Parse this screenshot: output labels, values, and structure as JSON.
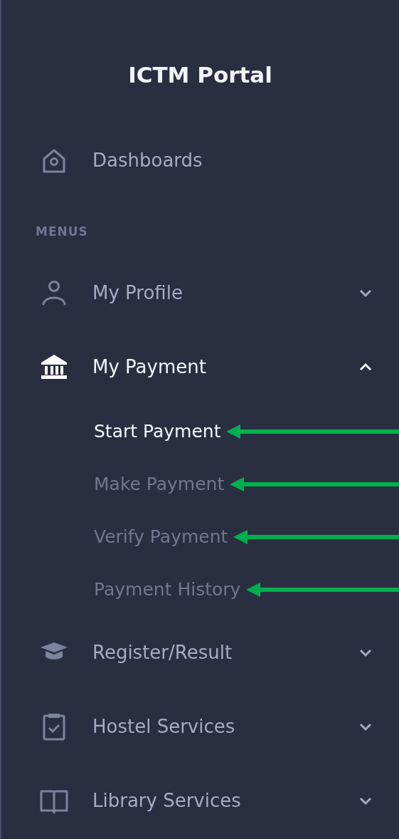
{
  "title": "ICTM Portal",
  "menu": [
    {
      "kind": "link",
      "label": "Dashboards"
    },
    {
      "kind": "header",
      "label": "MENUS"
    },
    {
      "kind": "group",
      "label": "My Profile",
      "expanded": false
    },
    {
      "kind": "group",
      "label": "My Payment",
      "expanded": true,
      "children": [
        {
          "label": "Start Payment",
          "selected": true,
          "pointed": true
        },
        {
          "label": "Make Payment",
          "selected": false,
          "pointed": true
        },
        {
          "label": "Verify Payment",
          "selected": false,
          "pointed": true
        },
        {
          "label": "Payment History",
          "selected": false,
          "pointed": true
        }
      ]
    },
    {
      "kind": "group",
      "label": "Register/Result",
      "expanded": false
    },
    {
      "kind": "group",
      "label": "Hostel Services",
      "expanded": false
    },
    {
      "kind": "group",
      "label": "Library Services",
      "expanded": false
    }
  ]
}
